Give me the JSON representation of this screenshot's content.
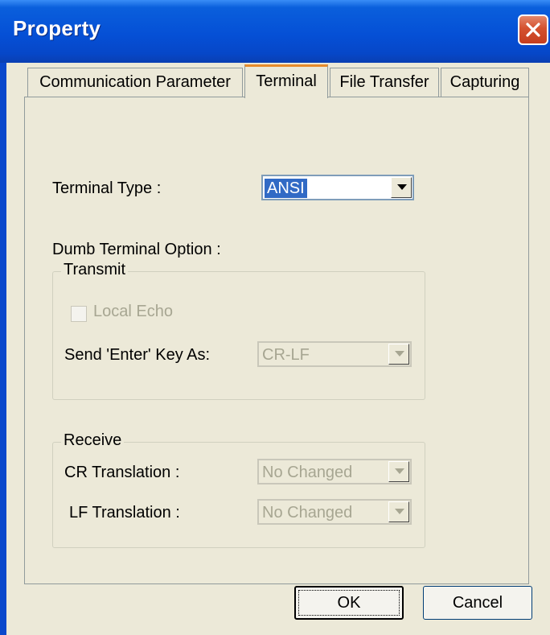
{
  "window": {
    "title": "Property"
  },
  "tabs": [
    {
      "label": "Communication Parameter",
      "active": false
    },
    {
      "label": "Terminal",
      "active": true
    },
    {
      "label": "File Transfer",
      "active": false
    },
    {
      "label": "Capturing",
      "active": false
    }
  ],
  "terminal": {
    "type_label": "Terminal Type :",
    "type_value": "ANSI",
    "dumb_option_label": "Dumb Terminal Option :",
    "transmit": {
      "legend": "Transmit",
      "local_echo_label": "Local Echo",
      "local_echo_checked": false,
      "send_enter_label": "Send 'Enter' Key  As:",
      "send_enter_value": "CR-LF"
    },
    "receive": {
      "legend": "Receive",
      "cr_label": "CR Translation :",
      "cr_value": "No Changed",
      "lf_label": "LF Translation :",
      "lf_value": "No Changed"
    }
  },
  "buttons": {
    "ok": "OK",
    "cancel": "Cancel"
  },
  "colors": {
    "title_bar": "#0550d6",
    "close_button": "#d4512f",
    "active_tab_accent": "#e68b2c",
    "selection": "#316ac5",
    "disabled_text": "#a7a692",
    "dialog_bg": "#ece9d8"
  }
}
